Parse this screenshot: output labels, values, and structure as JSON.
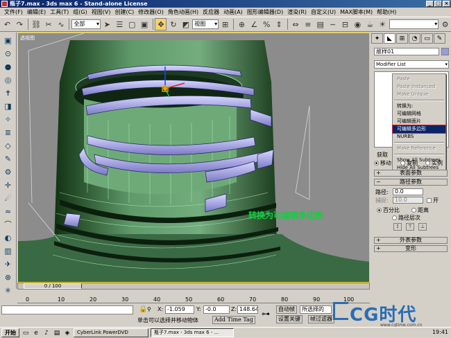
{
  "window": {
    "title": "瓶子7.max - 3ds max 6 - Stand-alone License",
    "controls": [
      "_",
      "□",
      "×"
    ]
  },
  "menu": [
    "文件(F)",
    "编辑(E)",
    "工具(T)",
    "组(G)",
    "视图(V)",
    "创建(C)",
    "修改器(O)",
    "角色动画(H)",
    "反应器",
    "动画(A)",
    "图形编辑器(D)",
    "渲染(R)",
    "自定义(U)",
    "MAX脚本(M)",
    "帮助(H)"
  ],
  "toolbar": {
    "selection_filter": "全部",
    "coord_system": "视图"
  },
  "viewport": {
    "label": "透视图",
    "annotation": "转换为可编辑多边形"
  },
  "command_panel": {
    "object_name": "故样01",
    "modifier_list": "Modifier List",
    "object_color": "#9b9bd8"
  },
  "context_menu": {
    "items": [
      {
        "label": "Paste",
        "disabled": true
      },
      {
        "label": "Paste Instanced",
        "disabled": true
      },
      {
        "label": "Make Unique",
        "disabled": true
      },
      {
        "sep": true
      },
      {
        "label": "转换为:",
        "disabled": false
      },
      {
        "label": "可编辑网格",
        "disabled": false
      },
      {
        "label": "可编辑面片",
        "disabled": false
      },
      {
        "label": "可编辑多边形",
        "disabled": false,
        "selected": true
      },
      {
        "label": "NURBS",
        "disabled": false
      },
      {
        "sep": true
      },
      {
        "label": "Make Reference",
        "disabled": true
      },
      {
        "sep": true
      },
      {
        "label": "Show All Subtrees",
        "disabled": false
      },
      {
        "label": "Hide All Subtrees",
        "disabled": false
      }
    ]
  },
  "rollouts": {
    "get_label": "获取",
    "move_label": "移动",
    "copy_label": "复制",
    "instance_label": "实例",
    "surface_params": "表面参数",
    "path_params": "路径参数",
    "path_label": "路径:",
    "path_value": "0.0",
    "snap_label": "捕捉:",
    "snap_value": "10.0",
    "on_label": "开",
    "percent_label": "百分比",
    "distance_label": "距离",
    "path_steps_label": "路径层次",
    "skin_params": "外表参数",
    "deform": "变形"
  },
  "timeline": {
    "slider": "0 / 100",
    "ticks": [
      "0",
      "10",
      "20",
      "30",
      "40",
      "50",
      "60",
      "70",
      "80",
      "90",
      "100"
    ]
  },
  "status": {
    "lock_icon": "lock-icon",
    "x_label": "X:",
    "x_value": "-1.059",
    "y_label": "Y:",
    "y_value": "-0.0",
    "z_label": "Z:",
    "z_value": "148.64",
    "auto_key": "自动帧",
    "set_key": "设置关键",
    "selected": "所选择的",
    "key_filters": "帧过滤器",
    "prompt": "单击可以选择并移动物体",
    "add_time_tag": "Add Time Tag"
  },
  "logo": {
    "text": "CG时代",
    "url": "www.cgtime.com.cn"
  },
  "taskbar": {
    "start": "开始",
    "tasks": [
      "CyberLink PowerDVD",
      "瓶子7.max - 3ds max 6 - ..."
    ],
    "time": "19:41"
  }
}
